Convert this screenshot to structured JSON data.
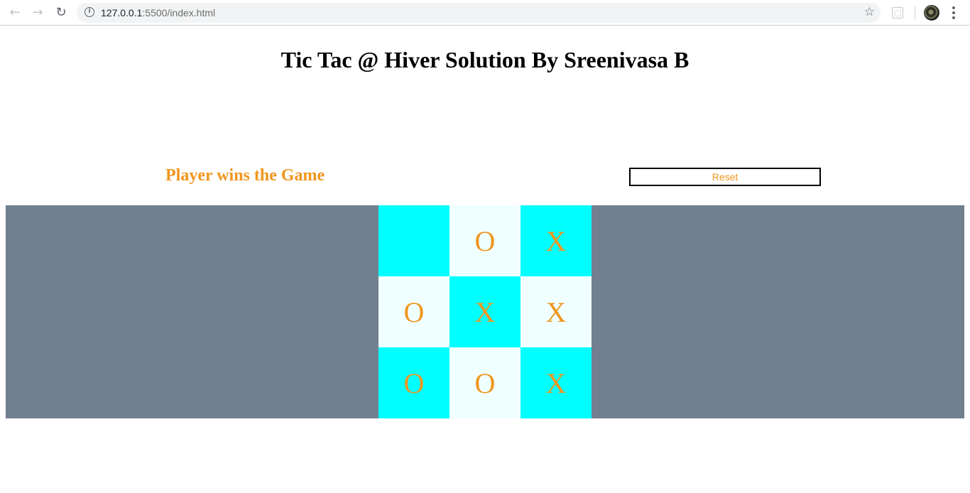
{
  "browser": {
    "url_host": "127.0.0.1",
    "url_path": ":5500/index.html"
  },
  "page": {
    "title": "Tic Tac @ Hiver Solution By Sreenivasa B",
    "status": "Player wins the Game",
    "reset_label": "Reset"
  },
  "board": {
    "cells": [
      "",
      "O",
      "X",
      "O",
      "X",
      "X",
      "O",
      "O",
      "X"
    ]
  },
  "colors": {
    "accent": "#f0961e",
    "band": "#717f8e",
    "cell_cyan": "#00ffff",
    "cell_light": "#f0ffff"
  },
  "icons": [
    "back-icon",
    "forward-icon",
    "reload-icon",
    "info-icon",
    "star-icon",
    "extension-icon",
    "avatar",
    "menu-icon"
  ]
}
